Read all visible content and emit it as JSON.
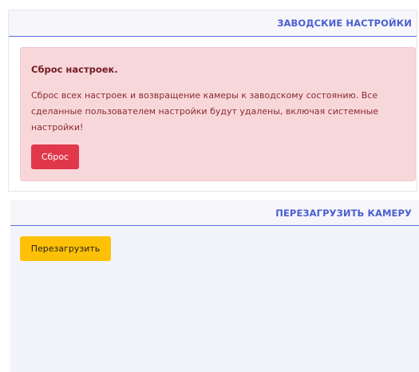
{
  "factory_reset_section": {
    "title": "ЗАВОДСКИЕ НАСТРОЙКИ",
    "alert": {
      "heading": "Сброс настроек.",
      "text": "Сброс всех настроек и возвращение камеры к заводскому состоянию. Все сделанные пользователем настройки будут удалены, включая системные настройки!",
      "button_label": "Сброс"
    }
  },
  "reboot_section": {
    "title": "ПЕРЕЗАГРУЗИТЬ КАМЕРУ",
    "button_label": "Перезагрузить"
  },
  "colors": {
    "accent": "#4a5fcf",
    "danger_button": "#e0374a",
    "alert_background": "#f8d7da",
    "alert_text": "#721c24",
    "warning_button": "#ffc107"
  }
}
